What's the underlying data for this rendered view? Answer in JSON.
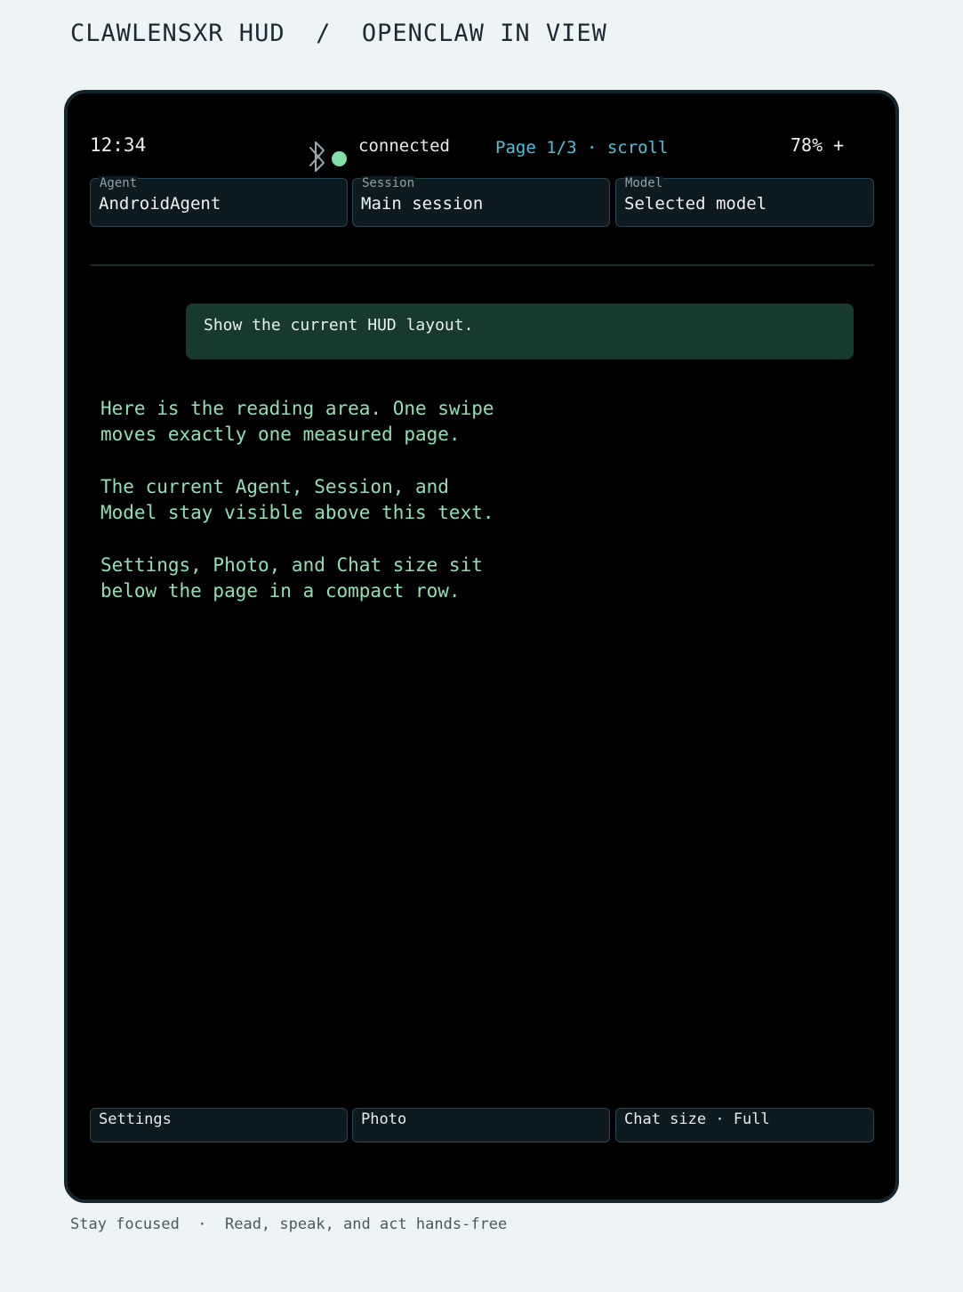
{
  "header": {
    "title": "CLAWLENSXR HUD  /  OPENCLAW IN VIEW"
  },
  "status_bar": {
    "time": "12:34",
    "bluetooth_icon": "bluetooth-icon",
    "connection_status": "connected",
    "connection_color": "#7fe0a8",
    "page_indicator": "Page 1/3 · scroll",
    "battery": "78% +"
  },
  "context": {
    "agent": {
      "label": "Agent",
      "value": "AndroidAgent"
    },
    "session": {
      "label": "Session",
      "value": "Main session"
    },
    "model": {
      "label": "Model",
      "value": "Selected model"
    }
  },
  "chat": {
    "user_message": "Show the current HUD layout.",
    "reply_paragraphs": [
      "Here is the reading area. One swipe\nmoves exactly one measured page.",
      "The current Agent, Session, and\nModel stay visible above this text.",
      "Settings, Photo, and Chat size sit\nbelow the page in a compact row."
    ]
  },
  "actions": {
    "settings": "Settings",
    "photo": "Photo",
    "chat_size": "Chat size · Full"
  },
  "footer": {
    "tagline": "Stay focused  ·  Read, speak, and act hands-free"
  }
}
